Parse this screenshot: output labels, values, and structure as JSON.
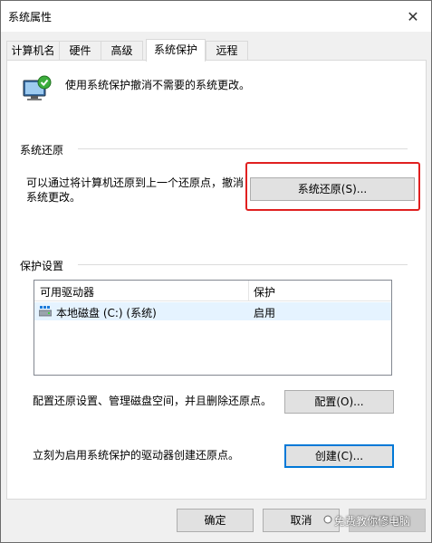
{
  "window": {
    "title": "系统属性",
    "close_glyph": "✕"
  },
  "tabs": [
    {
      "label": "计算机名"
    },
    {
      "label": "硬件"
    },
    {
      "label": "高级"
    },
    {
      "label": "系统保护"
    },
    {
      "label": "远程"
    }
  ],
  "active_tab": "系统保护",
  "intro": {
    "text": "使用系统保护撤消不需要的系统更改。",
    "icon": "system-protection-icon"
  },
  "restore": {
    "group_label": "系统还原",
    "description": "可以通过将计算机还原到上一个还原点，撤消系统更改。",
    "button_label": "系统还原(S)..."
  },
  "protection": {
    "group_label": "保护设置",
    "columns": [
      "可用驱动器",
      "保护"
    ],
    "rows": [
      {
        "drive": "本地磁盘 (C:) (系统)",
        "protection": "启用",
        "icon": "drive-icon"
      }
    ],
    "configure_text": "配置还原设置、管理磁盘空间，并且删除还原点。",
    "configure_button": "配置(O)...",
    "create_text": "立刻为启用系统保护的驱动器创建还原点。",
    "create_button": "创建(C)..."
  },
  "footer": {
    "ok": "确定",
    "cancel": "取消",
    "apply": "应用(A)"
  },
  "watermark": "免费教你修电脑",
  "colors": {
    "highlight": "#e02020",
    "focus": "#0078d7",
    "selection": "#e5f3ff"
  }
}
